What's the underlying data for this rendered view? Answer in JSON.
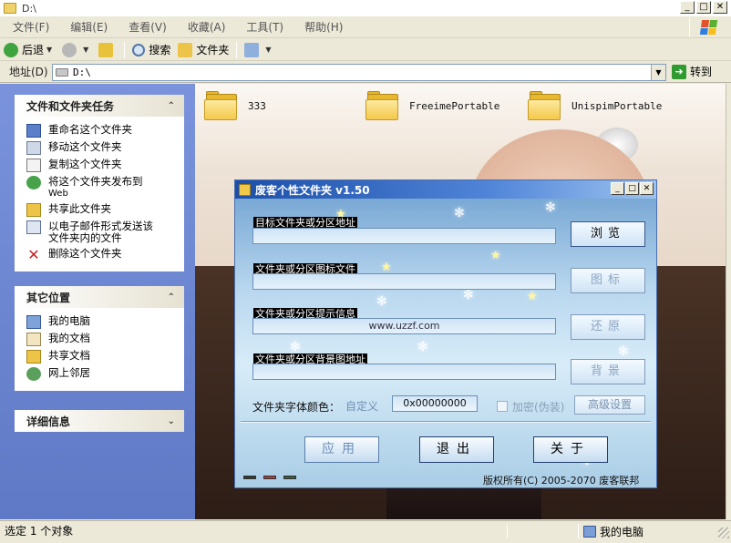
{
  "window": {
    "title": "D:\\"
  },
  "menu": {
    "items": [
      "文件(F)",
      "编辑(E)",
      "查看(V)",
      "收藏(A)",
      "工具(T)",
      "帮助(H)"
    ]
  },
  "toolbar": {
    "back": "后退",
    "search": "搜索",
    "folders": "文件夹"
  },
  "address": {
    "label": "地址(D)",
    "value": "D:\\",
    "go": "转到"
  },
  "tasks": {
    "header": "文件和文件夹任务",
    "items": [
      {
        "label": "重命名这个文件夹"
      },
      {
        "label": "移动这个文件夹"
      },
      {
        "label": "复制这个文件夹"
      },
      {
        "label": "将这个文件夹发布到",
        "label2": "Web"
      },
      {
        "label": "共享此文件夹"
      },
      {
        "label": "以电子邮件形式发送该",
        "label2": "文件夹内的文件"
      },
      {
        "label": "删除这个文件夹"
      }
    ]
  },
  "places": {
    "header": "其它位置",
    "items": [
      "我的电脑",
      "我的文档",
      "共享文档",
      "网上邻居"
    ]
  },
  "details": {
    "header": "详细信息"
  },
  "folders": [
    "333",
    "FreeimePortable",
    "UnispimPortable"
  ],
  "dialog": {
    "title": "废客个性文件夹 v1.50",
    "fields": [
      {
        "label": "目标文件夹或分区地址",
        "value": ""
      },
      {
        "label": "文件夹或分区图标文件",
        "value": ""
      },
      {
        "label": "文件夹或分区提示信息",
        "value": "www.uzzf.com"
      },
      {
        "label": "文件夹或分区背景图地址",
        "value": ""
      }
    ],
    "side_buttons": [
      "浏览",
      "图标",
      "还原",
      "背景"
    ],
    "font_color_label": "文件夹字体颜色：",
    "custom_label": "自定义",
    "hex_value": "0x00000000",
    "encrypt_label": "加密(伪装)",
    "advanced_label": "高级设置",
    "apply_label": "应用",
    "exit_label": "退出",
    "about_label": "关于",
    "copyright": "版权所有(C) 2005-2070 废客联邦",
    "swatch_colors": [
      "#2d3a2d",
      "#b03a3a",
      "#3a5a3a"
    ]
  },
  "status": {
    "left": "选定 1 个对象",
    "right": "我的电脑"
  }
}
